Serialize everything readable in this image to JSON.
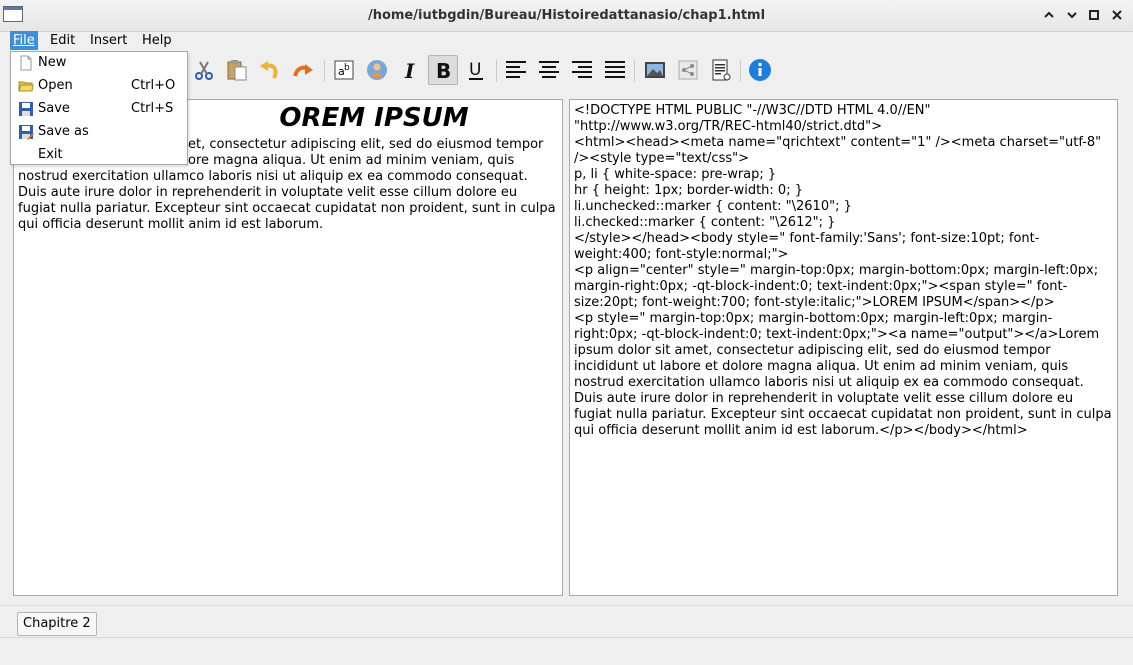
{
  "window": {
    "title": "/home/iutbgdin/Bureau/Histoiredattanasio/chap1.html"
  },
  "menubar": {
    "items": [
      {
        "label": "File"
      },
      {
        "label": "Edit"
      },
      {
        "label": "Insert"
      },
      {
        "label": "Help"
      }
    ]
  },
  "file_menu": {
    "items": [
      {
        "label": "New",
        "shortcut": "",
        "icon": "new-document-icon"
      },
      {
        "label": "Open",
        "shortcut": "Ctrl+O",
        "icon": "open-folder-icon"
      },
      {
        "label": "Save",
        "shortcut": "Ctrl+S",
        "icon": "save-icon"
      },
      {
        "label": "Save as",
        "shortcut": "",
        "icon": "save-as-icon"
      },
      {
        "label": "Exit",
        "shortcut": "",
        "icon": ""
      }
    ]
  },
  "toolbar": {
    "buttons": [
      {
        "icon": "cut-icon"
      },
      {
        "icon": "paste-icon"
      },
      {
        "icon": "undo-icon"
      },
      {
        "icon": "redo-icon"
      },
      {
        "icon": "spell-check-icon"
      },
      {
        "icon": "user-info-icon"
      },
      {
        "icon": "italic-icon"
      },
      {
        "icon": "bold-icon",
        "pressed": true
      },
      {
        "icon": "underline-icon"
      },
      {
        "icon": "align-left-icon"
      },
      {
        "icon": "align-center-icon"
      },
      {
        "icon": "align-right-icon"
      },
      {
        "icon": "justify-icon"
      },
      {
        "icon": "insert-image-icon"
      },
      {
        "icon": "share-icon"
      },
      {
        "icon": "document-settings-icon"
      },
      {
        "icon": "info-icon"
      }
    ]
  },
  "editor": {
    "heading": "LOREM IPSUM",
    "heading_visible": "OREM IPSUM",
    "body_line1_visible": "et, consectetur adipiscing elit, sed do eiusmod tempor",
    "body_line2_visible": "ore magna aliqua. Ut enim ad minim veniam, quis",
    "body_rest": "nostrud exercitation ullamco laboris nisi ut aliquip ex ea commodo consequat. Duis aute irure dolor in reprehenderit in voluptate velit esse cillum dolore eu fugiat nulla pariatur. Excepteur sint occaecat cupidatat non proident, sunt in culpa qui officia deserunt mollit anim id est laborum."
  },
  "source": {
    "text": "<!DOCTYPE HTML PUBLIC \"-//W3C//DTD HTML 4.0//EN\" \"http://www.w3.org/TR/REC-html40/strict.dtd\">\n<html><head><meta name=\"qrichtext\" content=\"1\" /><meta charset=\"utf-8\" /><style type=\"text/css\">\np, li { white-space: pre-wrap; }\nhr { height: 1px; border-width: 0; }\nli.unchecked::marker { content: \"\\2610\"; }\nli.checked::marker { content: \"\\2612\"; }\n</style></head><body style=\" font-family:'Sans'; font-size:10pt; font-weight:400; font-style:normal;\">\n<p align=\"center\" style=\" margin-top:0px; margin-bottom:0px; margin-left:0px; margin-right:0px; -qt-block-indent:0; text-indent:0px;\"><span style=\" font-size:20pt; font-weight:700; font-style:italic;\">LOREM IPSUM</span></p>\n<p style=\" margin-top:0px; margin-bottom:0px; margin-left:0px; margin-right:0px; -qt-block-indent:0; text-indent:0px;\"><a name=\"output\"></a>Lorem ipsum dolor sit amet, consectetur adipiscing elit, sed do eiusmod tempor incididunt ut labore et dolore magna aliqua. Ut enim ad minim veniam, quis nostrud exercitation ullamco laboris nisi ut aliquip ex ea commodo consequat. Duis aute irure dolor in reprehenderit in voluptate velit esse cillum dolore eu fugiat nulla pariatur. Excepteur sint occaecat cupidatat non proident, sunt in culpa qui officia deserunt mollit anim id est laborum.</p></body></html>"
  },
  "tabs": [
    {
      "label": "Chapitre 2"
    }
  ],
  "colors": {
    "accent": "#3e8ed8"
  }
}
